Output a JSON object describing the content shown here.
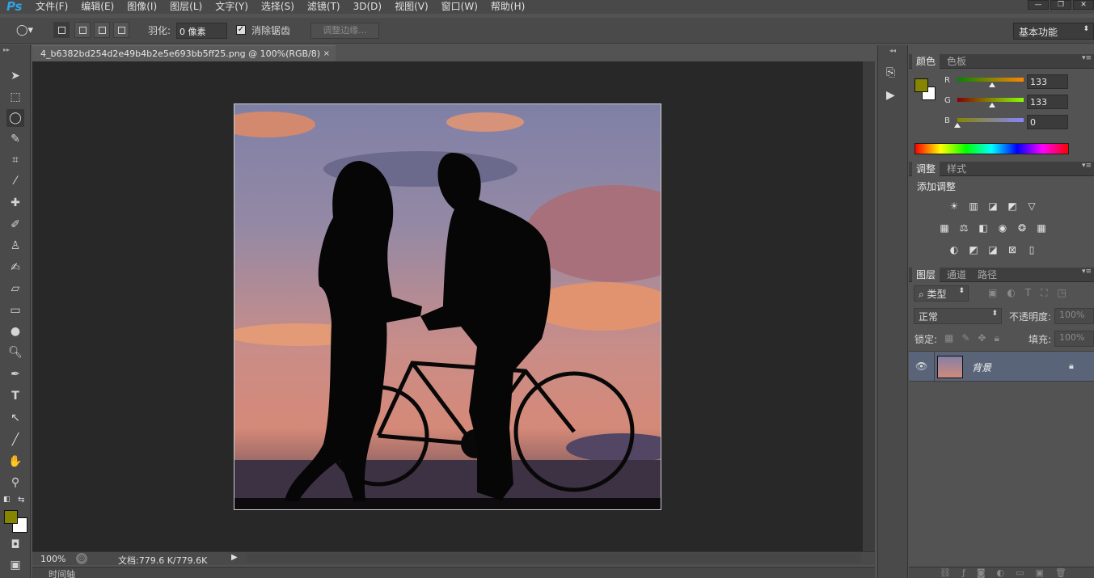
{
  "app": {
    "logo": "Ps"
  },
  "menubar": {
    "items": [
      "文件(F)",
      "编辑(E)",
      "图像(I)",
      "图层(L)",
      "文字(Y)",
      "选择(S)",
      "滤镜(T)",
      "3D(D)",
      "视图(V)",
      "窗口(W)",
      "帮助(H)"
    ]
  },
  "options": {
    "feather_label": "羽化:",
    "feather_value": "0 像素",
    "antialias_label": "消除锯齿",
    "antialias_checked": true,
    "refine_edge_label": "调整边缘...",
    "workspace": "基本功能"
  },
  "document": {
    "tab_title": "4_b6382bd254d2e49b4b2e5e693bb5ff25.png @ 100%(RGB/8)",
    "close_glyph": "×",
    "zoom": "100%",
    "doc_size": "文档:779.6 K/779.6K",
    "timeline_label": "时间轴"
  },
  "colors": {
    "foreground": "#858500",
    "background": "#ffffff",
    "accent": "#596478"
  },
  "color_panel": {
    "tabs": [
      "颜色",
      "色板"
    ],
    "channels": [
      {
        "label": "R",
        "value": "133",
        "fraction": 0.52
      },
      {
        "label": "G",
        "value": "133",
        "fraction": 0.52
      },
      {
        "label": "B",
        "value": "0",
        "fraction": 0.0
      }
    ]
  },
  "adjustments_panel": {
    "tabs": [
      "调整",
      "样式"
    ],
    "heading": "添加调整",
    "icons_row1": [
      "brightness-icon",
      "levels-icon",
      "curves-icon",
      "exposure-icon",
      "vibrance-icon"
    ],
    "icons_row2": [
      "hue-saturation-icon",
      "color-balance-icon",
      "black-white-icon",
      "photo-filter-icon",
      "channel-mixer-icon",
      "color-lookup-icon"
    ],
    "icons_row3": [
      "invert-icon",
      "posterize-icon",
      "threshold-icon",
      "selective-color-icon",
      "gradient-map-icon"
    ]
  },
  "layers_panel": {
    "tabs": [
      "图层",
      "通道",
      "路径"
    ],
    "filter_label": "类型",
    "blend_mode": "正常",
    "opacity_label": "不透明度:",
    "opacity_value": "100%",
    "lock_label": "锁定:",
    "fill_label": "填充:",
    "fill_value": "100%",
    "layers": [
      {
        "name": "背景",
        "visible": true,
        "locked": true
      }
    ]
  }
}
